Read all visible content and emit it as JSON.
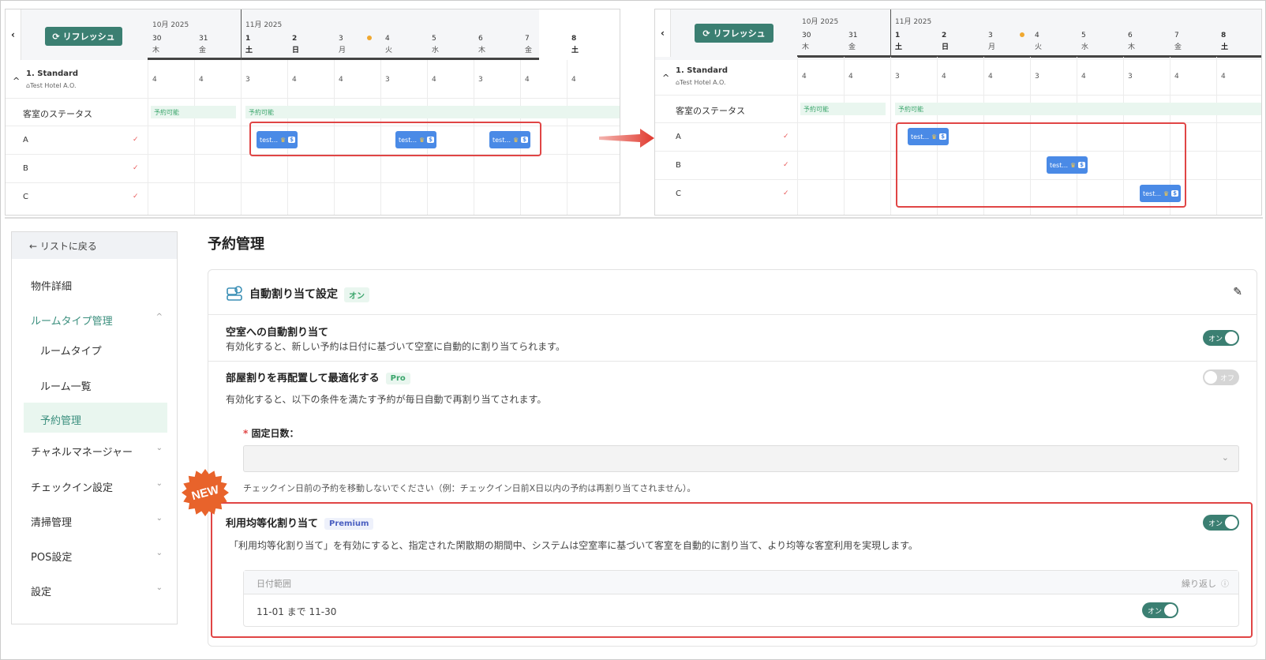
{
  "calendar": {
    "refresh_label": "リフレッシュ",
    "month_oct": "10月 2025",
    "month_nov": "11月 2025",
    "days": [
      {
        "num": "30",
        "name": "木"
      },
      {
        "num": "31",
        "name": "金"
      },
      {
        "num": "1",
        "name": "土"
      },
      {
        "num": "2",
        "name": "日"
      },
      {
        "num": "3",
        "name": "月"
      },
      {
        "num": "4",
        "name": "火"
      },
      {
        "num": "5",
        "name": "水"
      },
      {
        "num": "6",
        "name": "木"
      },
      {
        "num": "7",
        "name": "金"
      },
      {
        "num": "8",
        "name": "土"
      }
    ],
    "room_type": "1. Standard",
    "hotel": "Test Hotel A.O.",
    "counts": [
      "4",
      "4",
      "3",
      "4",
      "4",
      "3",
      "4",
      "3",
      "4",
      "4"
    ],
    "status_row_label": "客室のステータス",
    "status_available": "予約可能",
    "rooms": [
      "A",
      "B",
      "C"
    ],
    "chip_label": "test..."
  },
  "settings": {
    "back_label": "← リストに戻る",
    "menu": {
      "property_detail": "物件詳細",
      "roomtype_mgmt": "ルームタイプ管理",
      "roomtype": "ルームタイプ",
      "room_list": "ルーム一覧",
      "reservation_mgmt": "予約管理",
      "channel_manager": "チャネルマネージャー",
      "checkin": "チェックイン設定",
      "cleaning": "清掃管理",
      "pos": "POS設定",
      "settings": "設定"
    },
    "page_title": "予約管理",
    "card_title": "自動割り当て設定",
    "card_status": "オン",
    "auto_assign_title": "空室への自動割り当て",
    "auto_assign_desc": "有効化すると、新しい予約は日付に基づいて空室に自動的に割り当てられます。",
    "toggle_on": "オン",
    "toggle_off": "オフ",
    "reassign_title": "部屋割りを再配置して最適化する",
    "pro_tag": "Pro",
    "reassign_desc": "有効化すると、以下の条件を満たす予約が毎日自動で再割り当てされます。",
    "fixed_days_label": "固定日数：",
    "fixed_days_hint": "チェックイン日前の予約を移動しないでください（例：チェックイン日前X日以内の予約は再割り当てされません）。",
    "new_badge": "NEW",
    "equal_title": "利用均等化割り当て",
    "premium_tag": "Premium",
    "equal_desc": "「利用均等化割り当て」を有効にすると、指定された閑散期の期間中、システムは空室率に基づいて客室を自動的に割り当て、より均等な客室利用を実現します。",
    "table_col_date": "日付範囲",
    "table_col_repeat": "繰り返し",
    "table_row_range": "11-01 まで 11-30"
  }
}
